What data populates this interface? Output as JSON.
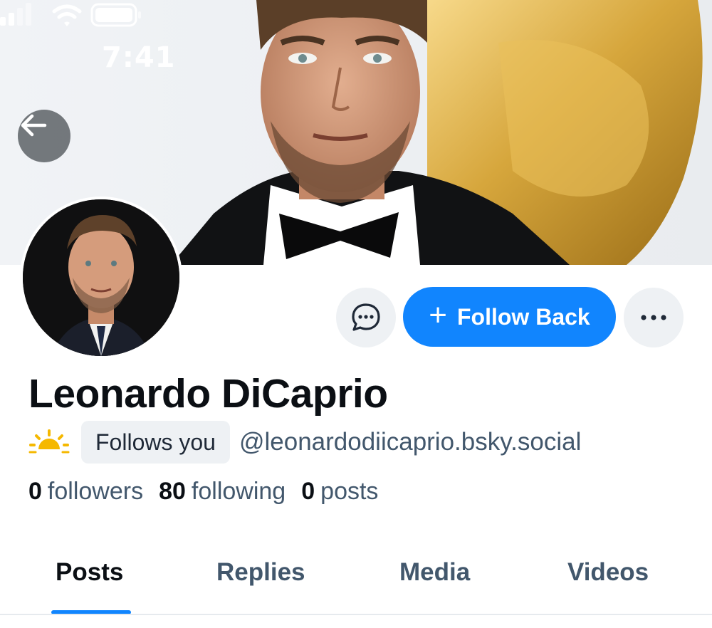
{
  "status_bar": {
    "time": "7:41"
  },
  "profile": {
    "display_name": "Leonardo DiCaprio",
    "handle": "@leonardodiicaprio.bsky.social",
    "follows_you_label": "Follows you",
    "stats": [
      {
        "count": "0",
        "label": "followers"
      },
      {
        "count": "80",
        "label": "following"
      },
      {
        "count": "0",
        "label": "posts"
      }
    ]
  },
  "actions": {
    "follow_back_label": "Follow Back"
  },
  "tabs": [
    {
      "label": "Posts",
      "active": true
    },
    {
      "label": "Replies",
      "active": false
    },
    {
      "label": "Media",
      "active": false
    },
    {
      "label": "Videos",
      "active": false
    }
  ],
  "icons": {
    "back": "arrow-left-icon",
    "message": "chat-bubble-dots-icon",
    "more": "ellipsis-icon",
    "badge": "sun-icon",
    "follow": "plus-icon"
  },
  "colors": {
    "accent": "#1185fe",
    "muted_text": "#42576c",
    "button_bg": "#eef1f4"
  }
}
